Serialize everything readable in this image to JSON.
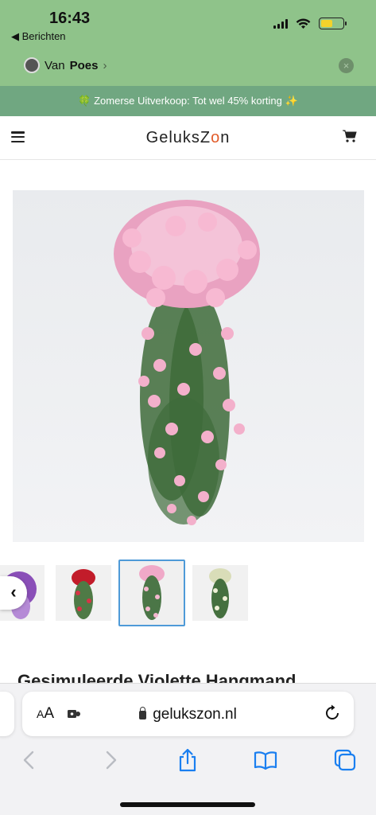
{
  "status": {
    "time": "16:43",
    "back_app": "◀ Berichten"
  },
  "contact": {
    "name_prefix": "Van ",
    "name": "Poes",
    "chevron": "›",
    "close_icon": "×"
  },
  "promo": {
    "text": "🍀 Zomerse Uitverkoop: Tot wel 45% korting ✨"
  },
  "site": {
    "logo_main": "GeluksZ",
    "logo_accent": "o",
    "logo_end": "n",
    "menu_icon": "hamburger-icon",
    "cart_icon": "cart-icon"
  },
  "product": {
    "title": "Gesimuleerde Violette Hangmand",
    "thumbnails": [
      "purple",
      "red",
      "pink",
      "white"
    ],
    "active_thumbnail": 2,
    "prev_arrow": "‹"
  },
  "safari": {
    "aa_small": "A",
    "aa_large": "A",
    "url": "gelukszon.nl"
  },
  "colors": {
    "status_green": "#8fc38a",
    "promo_green": "#70a781",
    "logo_accent": "#e25c2a",
    "thumb_border": "#4e9ad8",
    "ios_blue": "#1a7ff0"
  }
}
